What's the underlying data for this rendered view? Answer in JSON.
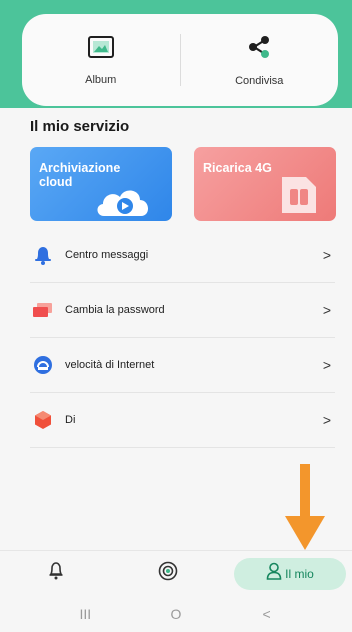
{
  "quick_actions": [
    {
      "label": "Album",
      "icon": "image-icon"
    },
    {
      "label": "Condivisa",
      "icon": "share-icon"
    }
  ],
  "section": {
    "title": "Il mio servizio"
  },
  "services": [
    {
      "label": "Archiviazione cloud",
      "icon": "cloud-play-icon",
      "color": "#3b8fee"
    },
    {
      "label": "Ricarica 4G",
      "icon": "sim-card-icon",
      "color": "#f08684"
    }
  ],
  "menu": [
    {
      "label": "Centro messaggi",
      "icon": "bell-icon",
      "color": "#2f6fe0"
    },
    {
      "label": "Cambia la password",
      "icon": "password-icon",
      "color": "#f04e4e"
    },
    {
      "label": "velocità di Internet",
      "icon": "speed-icon",
      "color": "#2f6fe0"
    },
    {
      "label": "Di",
      "icon": "hexagon-icon",
      "color": "#f0503a"
    }
  ],
  "tabbar": {
    "active_label": "Il mio",
    "accent": "#16865e"
  },
  "system_nav": {
    "recents": "III",
    "home": "O",
    "back": "<"
  },
  "annotation": {
    "arrow_color": "#f3962c"
  }
}
